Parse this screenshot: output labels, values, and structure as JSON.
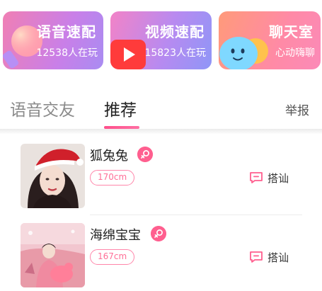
{
  "cards": [
    {
      "title": "语音速配",
      "subtitle": "12538人在玩",
      "icon": "microphone-icon"
    },
    {
      "title": "视频速配",
      "subtitle": "15823人在玩",
      "icon": "play-icon"
    },
    {
      "title": "聊天室",
      "subtitle": "心动嗨聊",
      "icon": "smiley-face-icon"
    }
  ],
  "tabs": {
    "voice": "语音交友",
    "recommend": "推荐",
    "active": "推荐"
  },
  "report_label": "举报",
  "users": [
    {
      "name": "狐兔兔",
      "gender": "female",
      "height": "170cm",
      "chat_label": "搭讪"
    },
    {
      "name": "海绵宝宝",
      "gender": "female",
      "height": "167cm",
      "chat_label": "搭讪"
    }
  ],
  "colors": {
    "accent": "#ff5f8f",
    "tab_underline": "#ff4f8b"
  }
}
